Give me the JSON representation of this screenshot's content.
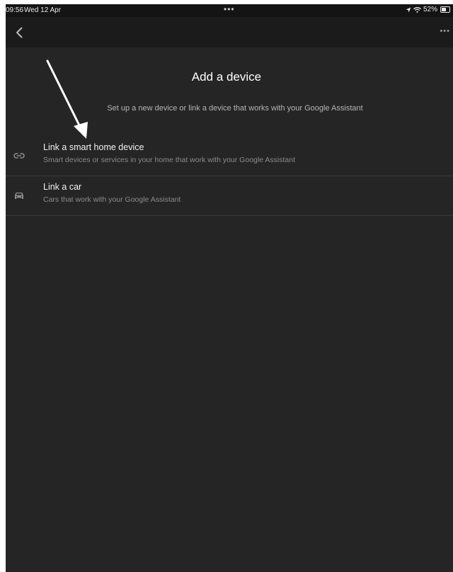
{
  "status_bar": {
    "time": "09:56",
    "date": "Wed 12 Apr",
    "center_dots": "•••",
    "battery": "52%"
  },
  "nav": {
    "back_icon": "chevron-left-icon",
    "more_label": "•••"
  },
  "page": {
    "title": "Add a device",
    "subtitle": "Set up a new device or link a device that works with your Google Assistant"
  },
  "items": [
    {
      "icon": "link-icon",
      "title": "Link a smart home device",
      "description": "Smart devices or services in your home that work with your Google Assistant"
    },
    {
      "icon": "car-icon",
      "title": "Link a car",
      "description": "Cars that work with your Google Assistant"
    }
  ],
  "colors": {
    "background": "#252525",
    "nav_background": "#1b1b1b",
    "title_text": "#ffffff",
    "secondary_text": "#8c8c8c"
  }
}
